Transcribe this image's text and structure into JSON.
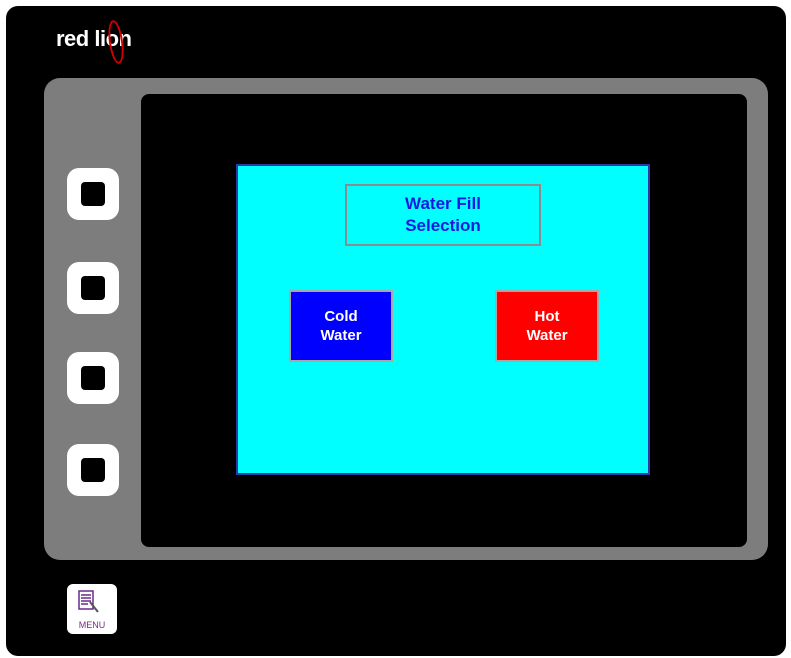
{
  "device": {
    "brand": "red lion",
    "colors": {
      "panel": "#00ffff",
      "cold": "#0000ff",
      "hot": "#ff0000",
      "title_text": "#1a1adf"
    }
  },
  "screen": {
    "title": "Water Fill\nSelection",
    "buttons": {
      "cold": "Cold\nWater",
      "hot": "Hot\nWater"
    }
  },
  "softkeys": [
    {
      "icon": "square-key-icon"
    },
    {
      "icon": "square-key-icon"
    },
    {
      "icon": "square-key-icon"
    },
    {
      "icon": "square-key-icon"
    }
  ],
  "menu_button": {
    "label": "MENU",
    "icon": "menu-icon"
  }
}
